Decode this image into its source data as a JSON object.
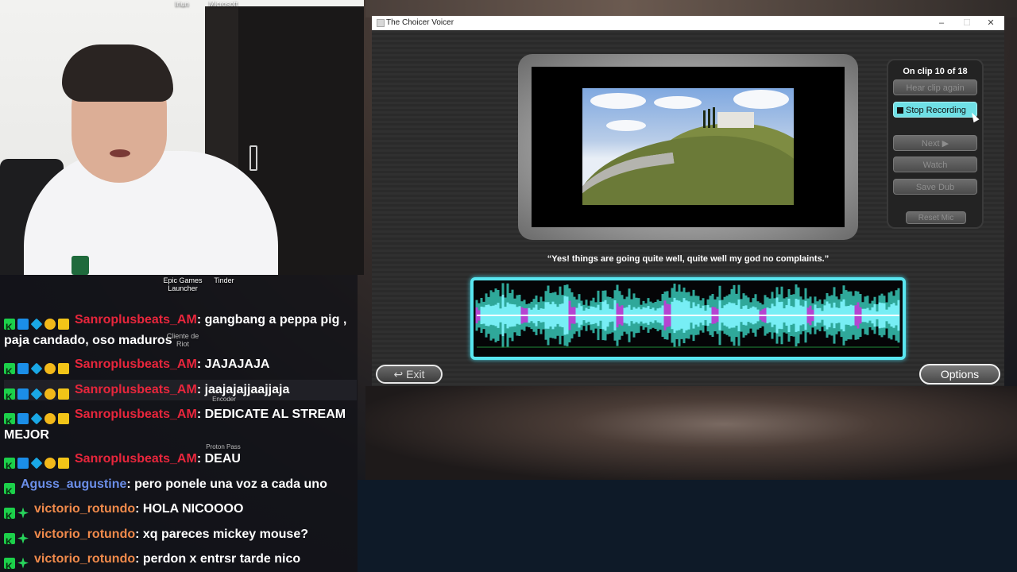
{
  "desktop": {
    "top_icons": [
      "Iriun",
      "Microsoft"
    ],
    "icons": [
      {
        "label": "Epic Games Launcher"
      },
      {
        "label": "Tinder"
      },
      {
        "label": "Cliente de Riot"
      },
      {
        "label": "Encoder"
      },
      {
        "label": "Proton Pass"
      }
    ]
  },
  "chat": {
    "messages": [
      {
        "user": "Sanroplusbeats_AM",
        "text": ": gangbang a peppa pig , paja candado, oso maduros",
        "badges": [
          "kick",
          "verify",
          "gem",
          "coin",
          "crown"
        ],
        "color": "#e8263c"
      },
      {
        "user": "Sanroplusbeats_AM",
        "text": ": JAJAJAJA",
        "badges": [
          "kick",
          "verify",
          "gem",
          "coin",
          "crown"
        ],
        "color": "#e8263c"
      },
      {
        "user": "Sanroplusbeats_AM",
        "text": ": jaajajajjaajjaja",
        "badges": [
          "kick",
          "verify",
          "gem",
          "coin",
          "crown"
        ],
        "color": "#e8263c"
      },
      {
        "user": "Sanroplusbeats_AM",
        "text": ": DEDICATE AL STREAM MEJOR",
        "badges": [
          "kick",
          "verify",
          "gem",
          "coin",
          "crown"
        ],
        "color": "#e8263c"
      },
      {
        "user": "Sanroplusbeats_AM",
        "text": ": DEAU",
        "badges": [
          "kick",
          "verify",
          "gem",
          "coin",
          "crown"
        ],
        "color": "#e8263c"
      },
      {
        "user": "Aguss_augustine",
        "text": ": pero ponele una voz a cada uno",
        "badges": [
          "kick"
        ],
        "color": "#6b8ee8"
      },
      {
        "user": "victorio_rotundo",
        "text": ": HOLA NICOOOO",
        "badges": [
          "kick",
          "spark"
        ],
        "color": "#f08a4b"
      },
      {
        "user": "victorio_rotundo",
        "text": ": xq pareces mickey mouse?",
        "badges": [
          "kick",
          "spark"
        ],
        "color": "#f08a4b"
      },
      {
        "user": "victorio_rotundo",
        "text": ": perdon x entrsr tarde nico",
        "badges": [
          "kick",
          "spark"
        ],
        "color": "#f08a4b"
      }
    ]
  },
  "window": {
    "title": "The Choicer Voicer",
    "controls": {
      "minimize": "–",
      "maximize": "☐",
      "close": "✕"
    },
    "clip_status": "On clip 10 of 18",
    "buttons": {
      "hear_again": "Hear clip again",
      "stop_recording": "Stop Recording",
      "next": "Next ▶",
      "watch": "Watch",
      "save_dub": "Save Dub",
      "reset_mic": "Reset Mic",
      "exit": "↩ Exit",
      "options": "Options"
    },
    "subtitle": "“Yes! things are going quite well, quite well my god no complaints.”"
  },
  "colors": {
    "accent": "#59e6f0",
    "wave_teal": "#2fa89a",
    "wave_cyan": "#7ff6ff",
    "wave_magenta": "#c43ad8"
  }
}
